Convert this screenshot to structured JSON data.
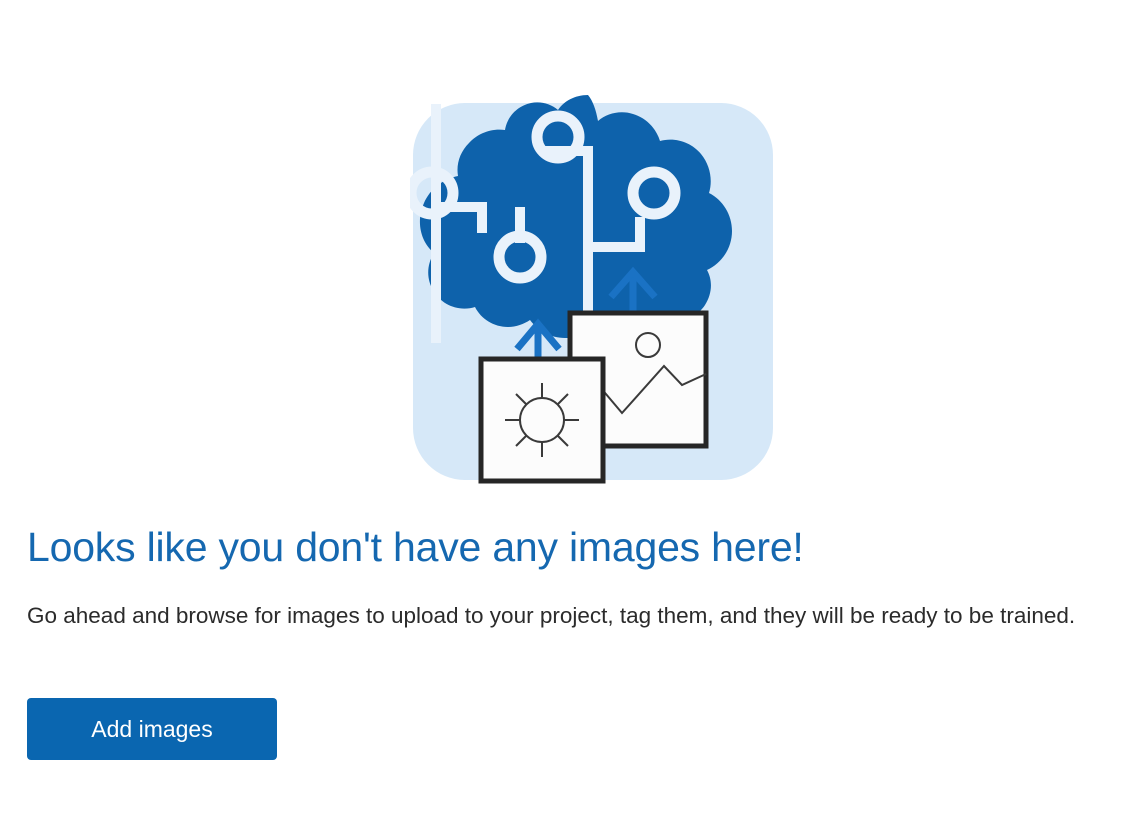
{
  "empty_state": {
    "headline": "Looks like you don't have any images here!",
    "subtext": "Go ahead and browse for images to upload to your project, tag them, and they will be ready to be trained.",
    "primary_button_label": "Add images",
    "illustration": {
      "name": "ai-brain-image-upload-illustration",
      "panel_color": "#d6e8f8",
      "brain_color": "#0e62ab",
      "circuit_color": "#e9f2fb",
      "arrow_color": "#1a72c4",
      "card_border_color": "#262626",
      "card_fill_color": "#fcfcfc",
      "card_detail_color": "#3a3a3a",
      "elements": [
        "cloud-brain-icon",
        "circuit-node-icon",
        "upload-arrow-icon",
        "sun-photo-card-icon",
        "landscape-photo-card-icon"
      ]
    },
    "colors": {
      "headline": "#1568b0",
      "subtext": "#2b2b2b",
      "button_background": "#0a66b0",
      "button_text": "#ffffff",
      "page_background": "#ffffff"
    }
  }
}
